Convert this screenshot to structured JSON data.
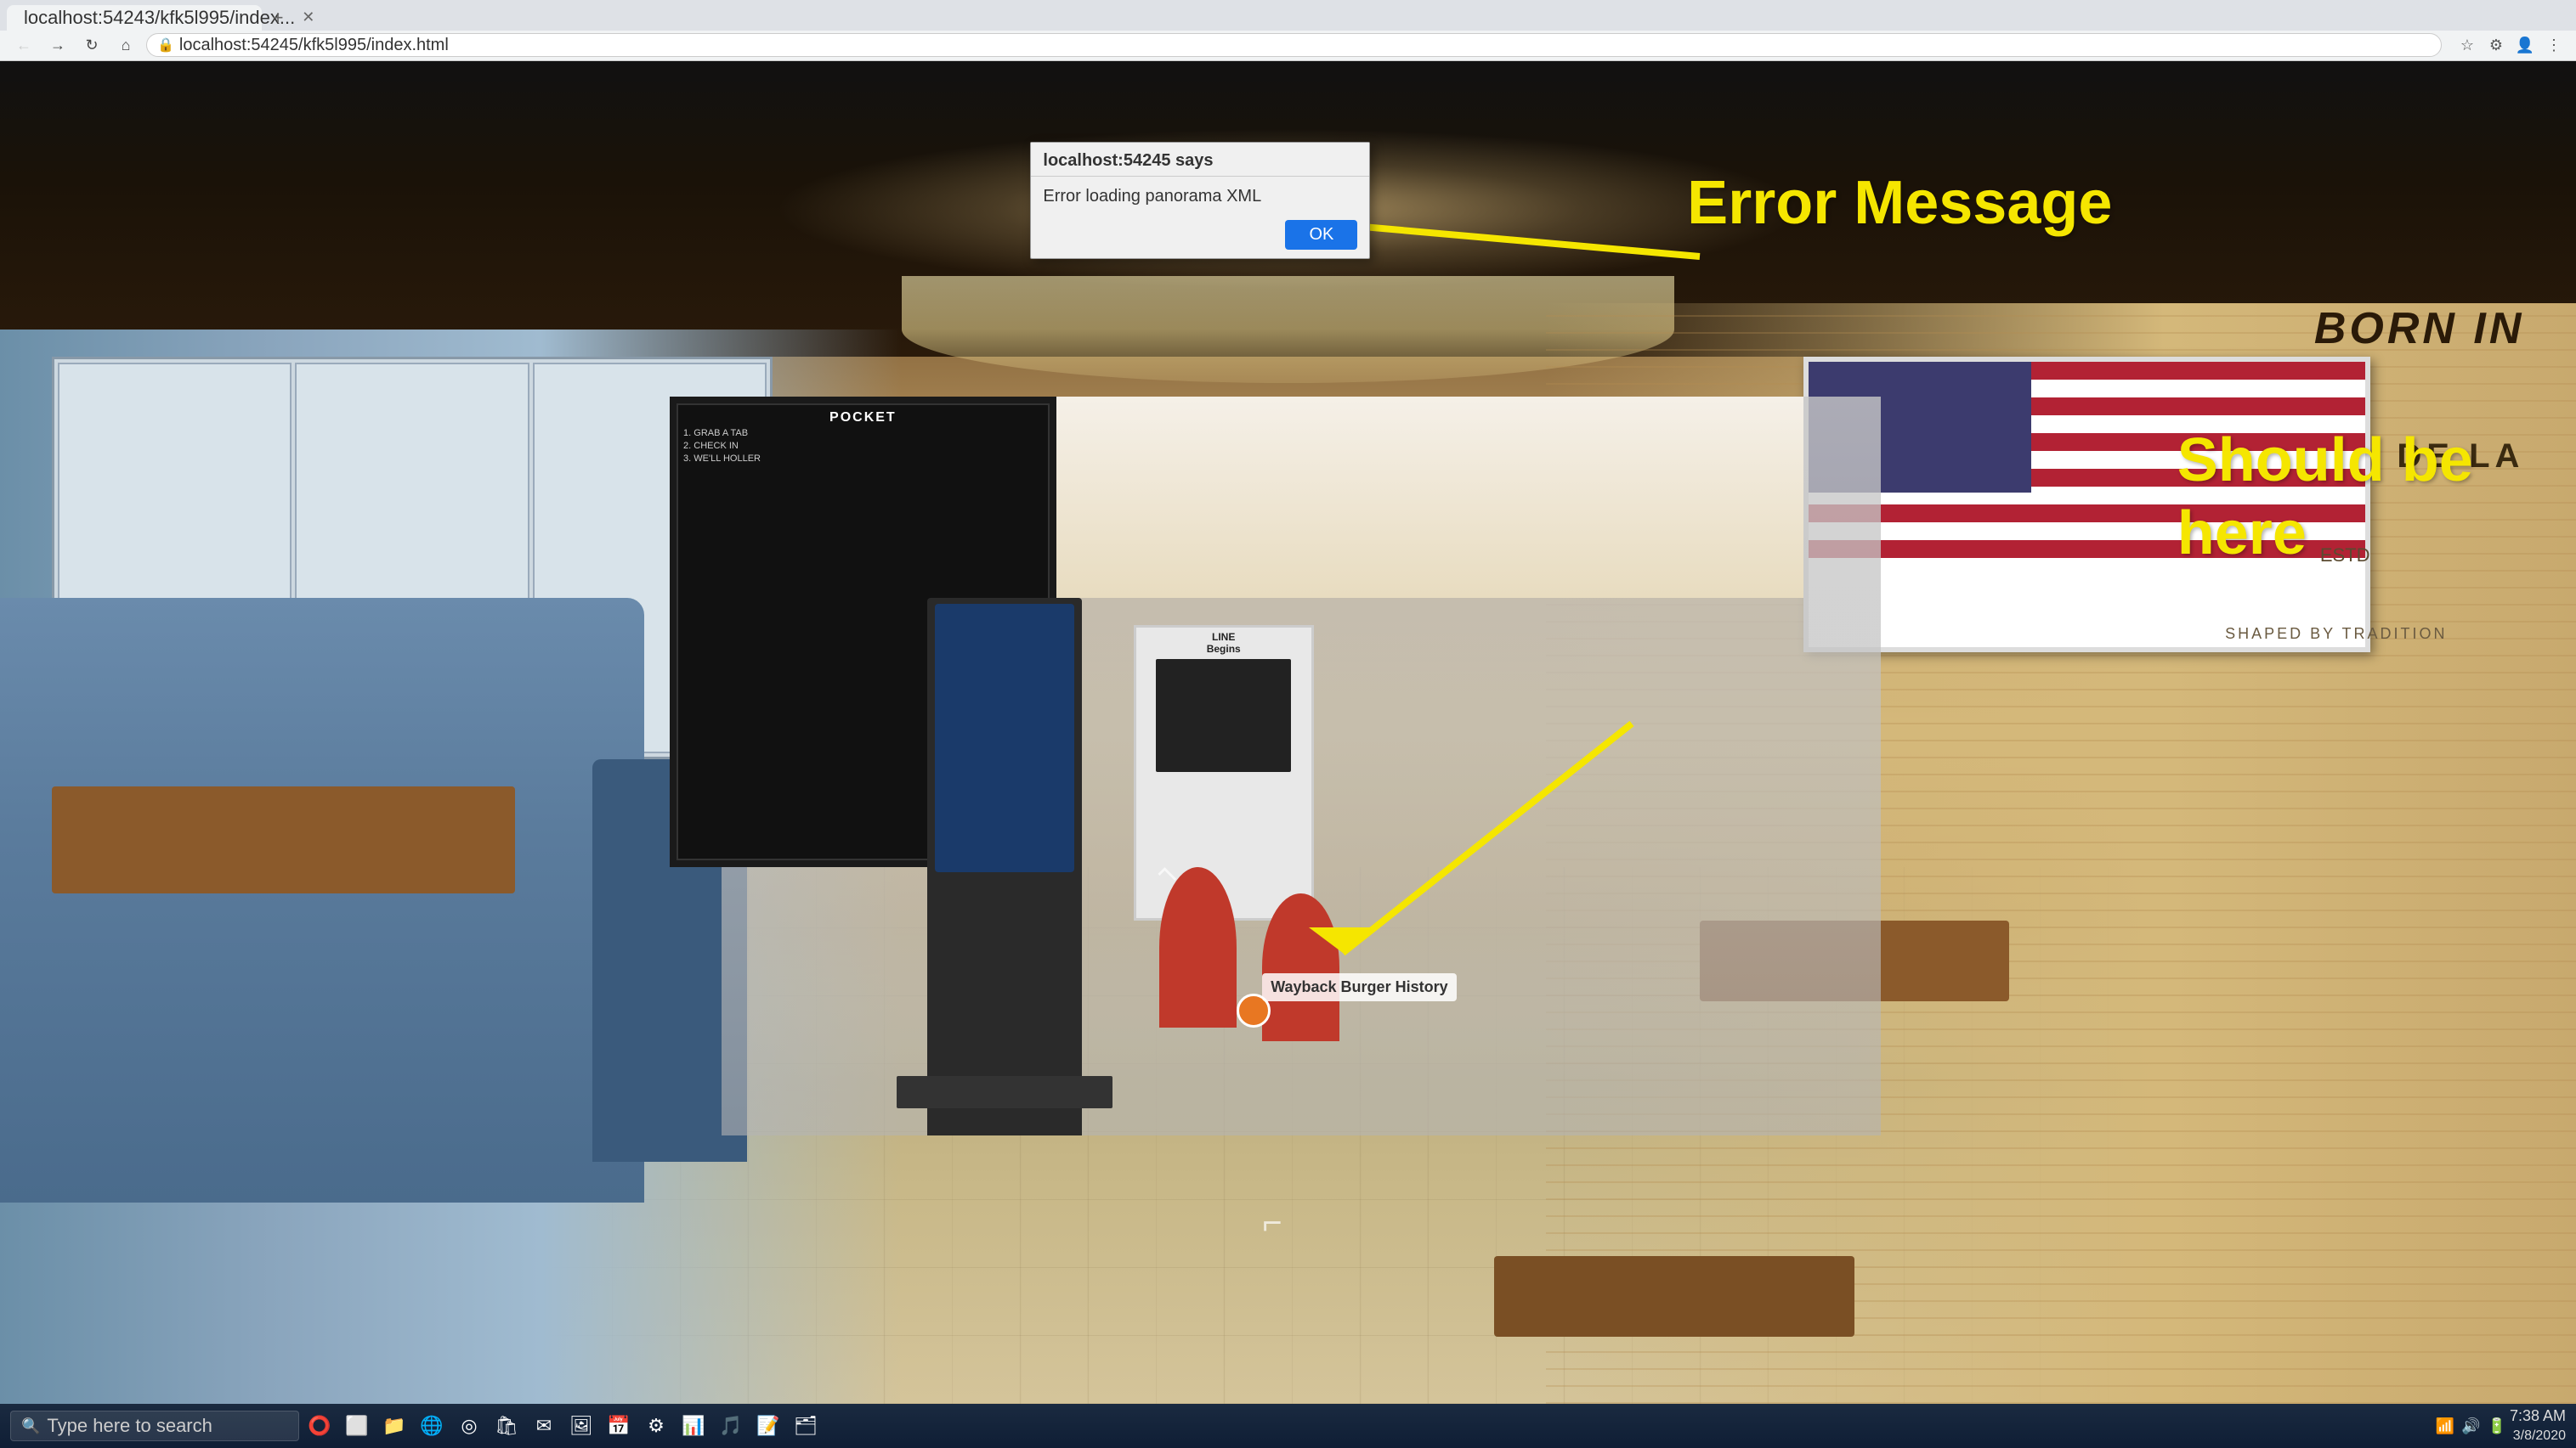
{
  "browser": {
    "tab_title": "localhost:54243/kfk5l995/index...",
    "url": "localhost:54245/kfk5l995/index.html",
    "favicon_color": "#4a90d9"
  },
  "modal": {
    "title": "localhost:54245 says",
    "body": "Error loading panorama XML",
    "ok_label": "OK"
  },
  "annotations": {
    "error_message_label": "Error Message",
    "should_be_here_label": "Should be\nhere"
  },
  "restaurant": {
    "born_in_text": "BORN IN",
    "dela_text": "DE LA",
    "estd_text": "ESTD",
    "shaped_text": "SHAPED BY TRADITION",
    "menu_board_title": "POCKET",
    "menu_items": [
      "1. GRAB A TAB",
      "2. CHECK IN",
      "3. WE'LL HOLLER"
    ],
    "line_begins_text": "LINE\nBegins",
    "wayback_label": "Wayback Burger\nHistory"
  },
  "taskbar": {
    "search_placeholder": "Type here to search",
    "time": "7:38 AM",
    "date": "3/8/2020"
  },
  "nav_icons": {
    "back": "←",
    "forward": "→",
    "refresh": "↻",
    "home": "⌂",
    "extensions": "⚙",
    "menu": "⋮"
  }
}
